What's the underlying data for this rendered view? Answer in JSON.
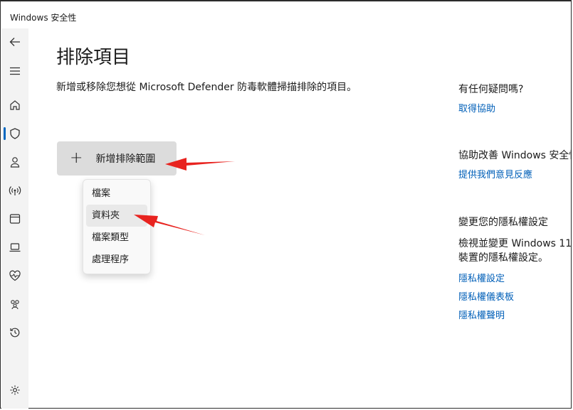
{
  "window": {
    "title": "Windows 安全性"
  },
  "nav": {
    "items": [
      {
        "icon": "back-arrow-icon"
      },
      {
        "icon": "hamburger-menu-icon"
      },
      {
        "icon": "home-icon"
      },
      {
        "icon": "shield-icon",
        "active": true
      },
      {
        "icon": "account-icon"
      },
      {
        "icon": "wireless-network-icon"
      },
      {
        "icon": "app-browser-icon"
      },
      {
        "icon": "laptop-icon"
      },
      {
        "icon": "heart-pulse-icon"
      },
      {
        "icon": "family-icon"
      },
      {
        "icon": "history-icon"
      },
      {
        "icon": "settings-gear-icon"
      }
    ]
  },
  "main": {
    "title": "排除項目",
    "description": "新增或移除您想從 Microsoft Defender 防毒軟體掃描排除的項目。",
    "add_button": {
      "icon": "plus-icon",
      "label": "新增排除範圍"
    },
    "dropdown": {
      "items": [
        {
          "label": "檔案"
        },
        {
          "label": "資料夾",
          "hovered": true
        },
        {
          "label": "檔案類型"
        },
        {
          "label": "處理程序"
        }
      ]
    }
  },
  "sidebar": {
    "help": {
      "heading": "有任何疑問嗎?",
      "link": "取得協助"
    },
    "improve": {
      "heading": "協助改善 Windows 安全性",
      "link": "提供我們意見反應"
    },
    "privacy": {
      "heading": "變更您的隱私權設定",
      "text": "檢視並變更 Windows 11 裝置的隱私權設定。",
      "links": [
        "隱私權設定",
        "隱私權儀表板",
        "隱私權聲明"
      ]
    }
  },
  "colors": {
    "accent": "#0067c0",
    "link": "#005fb8",
    "annotation_arrow": "#e8231f"
  }
}
